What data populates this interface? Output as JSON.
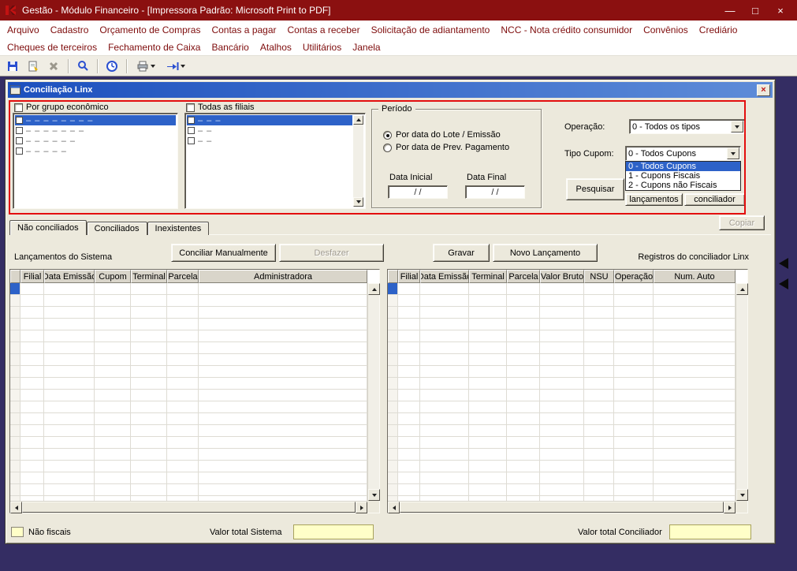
{
  "titlebar": {
    "title": "Gestão - Módulo Financeiro - [Impressora Padrão: Microsoft Print to PDF]",
    "minimize_glyph": "—",
    "maximize_glyph": "□",
    "close_glyph": "×"
  },
  "menubar": {
    "row1": [
      "Arquivo",
      "Cadastro",
      "Orçamento de Compras",
      "Contas a pagar",
      "Contas a receber",
      "Solicitação de adiantamento",
      "NCC - Nota crédito consumidor",
      "Convênios",
      "Crediário"
    ],
    "row2": [
      "Cheques de terceiros",
      "Fechamento de Caixa",
      "Bancário",
      "Atalhos",
      "Utilitários",
      "Janela"
    ]
  },
  "toolbar": {
    "icons": [
      "save",
      "new-document",
      "delete",
      "search",
      "clock",
      "print",
      "export"
    ]
  },
  "dialog": {
    "title": "Conciliação Linx",
    "close_glyph": "×",
    "filters": {
      "group_checkbox_label": "Por grupo econômico",
      "group_list_items": [
        "– – – – – – – –",
        "– – – – – – –",
        "– – – – – –",
        "– – – – –"
      ],
      "branches_checkbox_label": "Todas as filiais",
      "branches_list_items": [
        "– – –",
        "– –",
        "– –"
      ],
      "period": {
        "legend": "Período",
        "radio_lote": "Por data do Lote / Emissão",
        "radio_prev": "Por data de Prev. Pagamento",
        "data_inicial_label": "Data Inicial",
        "data_final_label": "Data Final",
        "data_inicial_value": "/ /",
        "data_final_value": "/ /"
      },
      "operacao_label": "Operação:",
      "operacao_value": "0 - Todos os tipos",
      "tipo_cupom_label": "Tipo Cupom:",
      "tipo_cupom_value": "0 - Todos Cupons",
      "tipo_cupom_options": [
        "0 - Todos Cupons",
        "1 - Cupons Fiscais",
        "2 - Cupons não Fiscais"
      ],
      "pesquisar_button": "Pesquisar",
      "lancamentos_button": "lançamentos",
      "conciliador_button": "conciliador"
    },
    "tabs": [
      "Não conciliados",
      "Conciliados",
      "Inexistentes"
    ],
    "copiar_button": "Copiar",
    "buttons": {
      "conciliar": "Conciliar Manualmente",
      "desfazer": "Desfazer",
      "gravar": "Gravar",
      "novo": "Novo Lançamento"
    },
    "left_grid": {
      "caption": "Lançamentos do Sistema",
      "columns": [
        "Filial",
        "Data Emissão",
        "Cupom",
        "Terminal",
        "Parcela",
        "Administradora"
      ]
    },
    "right_grid": {
      "caption": "Registros do conciliador Linx",
      "columns": [
        "Filial",
        "Data Emissão",
        "Terminal",
        "Parcela",
        "Valor Bruto",
        "NSU",
        "Operação",
        "Num. Auto"
      ]
    },
    "footer": {
      "nao_fiscais_label": "Não fiscais",
      "valor_total_sistema_label": "Valor total Sistema",
      "valor_total_sistema_value": "",
      "valor_total_conciliador_label": "Valor total Conciliador",
      "valor_total_conciliador_value": ""
    }
  },
  "colors": {
    "titlebar_red": "#8B1010",
    "menu_text_red": "#7E0C0C",
    "mdi_background": "#342D63",
    "dialog_title_blue": "#1C50BE",
    "selection_blue": "#2D62C8",
    "highlight_yellow": "#FFFFC8",
    "annotation_red": "#E30E0E"
  }
}
